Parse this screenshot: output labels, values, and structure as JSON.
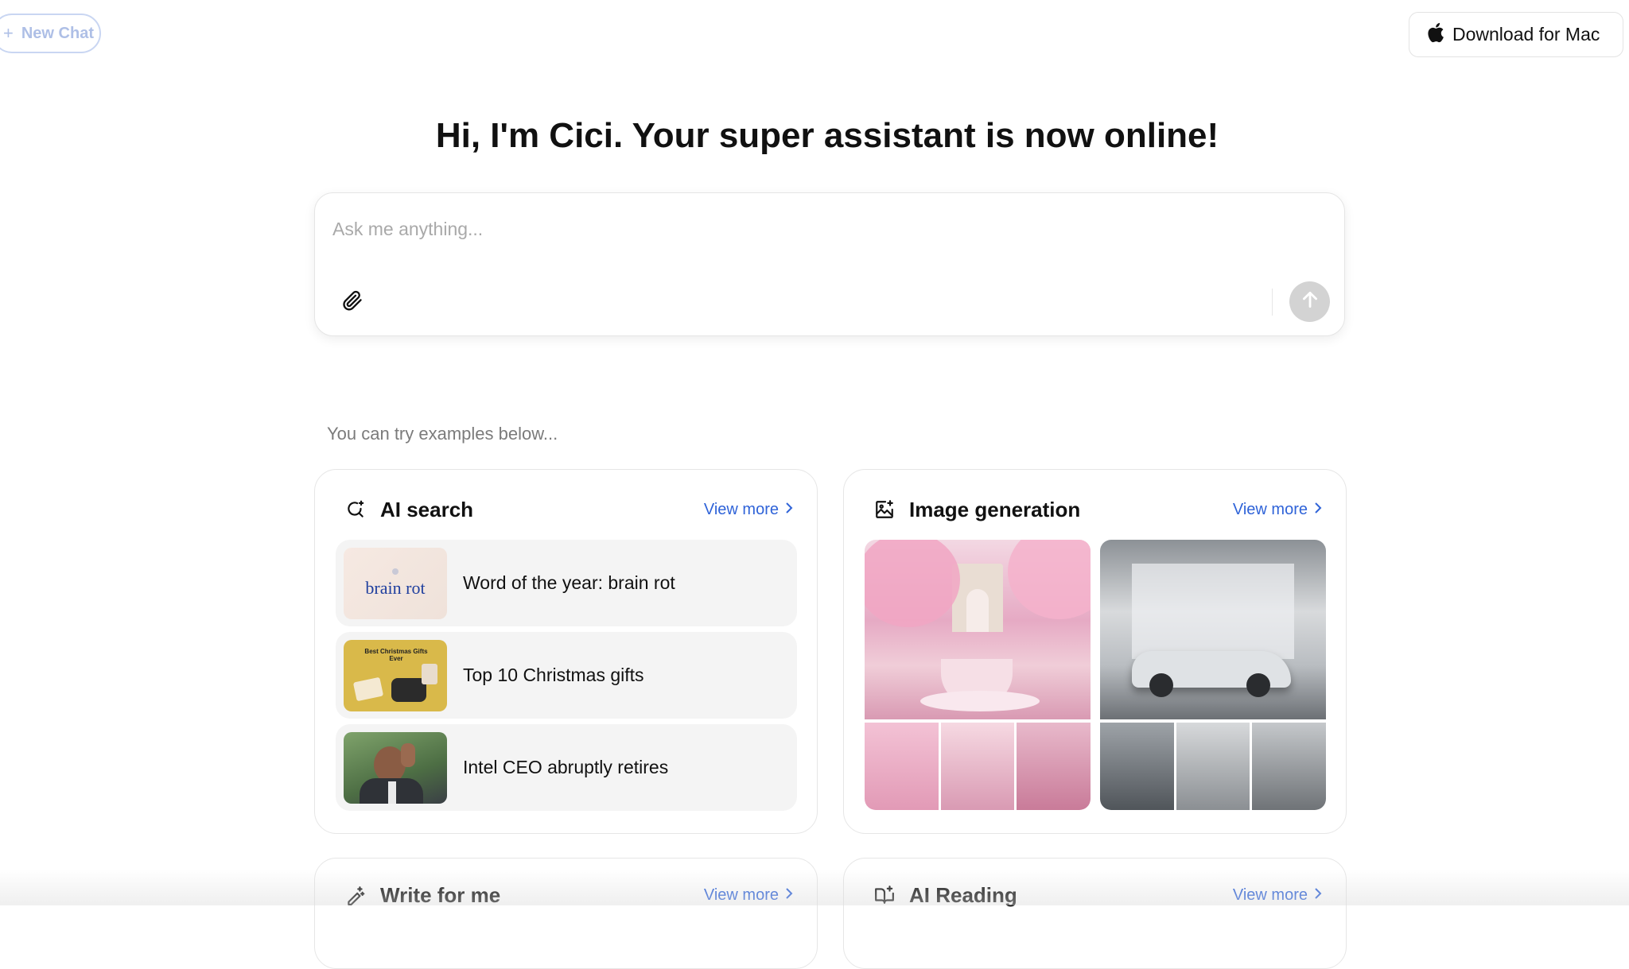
{
  "header": {
    "new_chat_label": "New Chat",
    "download_label": "Download for Mac"
  },
  "hero": {
    "title": "Hi, I'm Cici. Your super assistant is now online!"
  },
  "composer": {
    "placeholder": "Ask me anything...",
    "value": ""
  },
  "examples": {
    "hint": "You can try examples below..."
  },
  "cards": {
    "ai_search": {
      "title": "AI search",
      "view_more": "View more",
      "items": [
        {
          "label": "Word of the year: brain rot",
          "thumb_text": "brain rot"
        },
        {
          "label": "Top 10 Christmas gifts",
          "thumb_text": "Best Christmas Gifts Ever"
        },
        {
          "label": "Intel CEO abruptly retires"
        }
      ]
    },
    "image_generation": {
      "title": "Image generation",
      "view_more": "View more"
    },
    "write_for_me": {
      "title": "Write for me",
      "view_more": "View more"
    },
    "ai_reading": {
      "title": "AI Reading",
      "view_more": "View more"
    }
  },
  "colors": {
    "accent_link": "#2f63d8",
    "send_button_disabled": "#d3d3d3"
  }
}
